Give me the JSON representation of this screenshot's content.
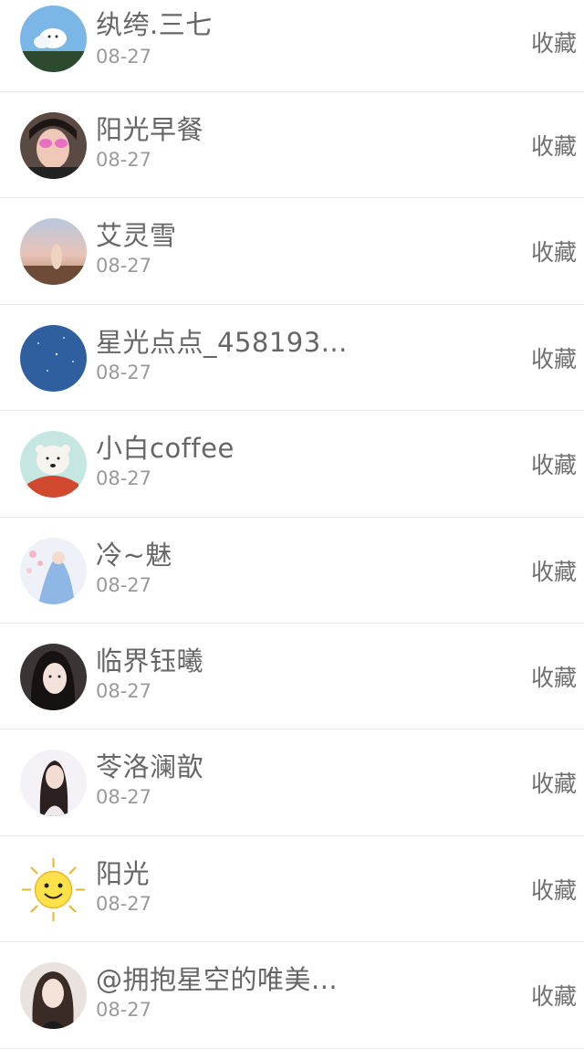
{
  "items": [
    {
      "name": "纨绔.三七",
      "date": "08-27",
      "action": "收藏",
      "avatar": "cloud-sky-avatar"
    },
    {
      "name": "阳光早餐",
      "date": "08-27",
      "action": "收藏",
      "avatar": "girl-sunglasses-avatar"
    },
    {
      "name": "艾灵雪",
      "date": "08-27",
      "action": "收藏",
      "avatar": "sunset-hand-avatar"
    },
    {
      "name": "星光点点_458193...",
      "date": "08-27",
      "action": "收藏",
      "avatar": "blue-starry-avatar"
    },
    {
      "name": "小白coffee",
      "date": "08-27",
      "action": "收藏",
      "avatar": "polar-bear-scarf-avatar"
    },
    {
      "name": "冷~魅",
      "date": "08-27",
      "action": "收藏",
      "avatar": "anime-girl-blue-avatar"
    },
    {
      "name": "临界钰曦",
      "date": "08-27",
      "action": "收藏",
      "avatar": "dark-hair-girl-avatar"
    },
    {
      "name": "苓洛澜歆",
      "date": "08-27",
      "action": "收藏",
      "avatar": "woman-portrait-avatar"
    },
    {
      "name": "阳光",
      "date": "08-27",
      "action": "收藏",
      "avatar": "smiling-sun-avatar"
    },
    {
      "name": "@拥抱星空的唯美...",
      "date": "08-27",
      "action": "收藏",
      "avatar": "long-hair-girl-avatar"
    }
  ]
}
